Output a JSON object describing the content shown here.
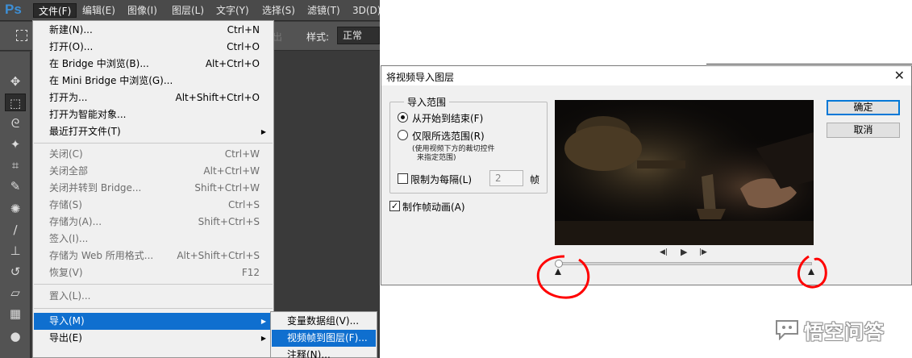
{
  "photoshop": {
    "logo": "Ps",
    "menubar": [
      "文件(F)",
      "编辑(E)",
      "图像(I)",
      "图层(L)",
      "文字(Y)",
      "选择(S)",
      "滤镜(T)",
      "3D(D)"
    ],
    "options": {
      "hidden_text": "出",
      "style_label": "样式:",
      "style_value": "正常"
    },
    "tool_icons": [
      "move-tool-icon",
      "marquee-tool-icon",
      "lasso-tool-icon",
      "magic-wand-icon",
      "crop-tool-icon",
      "eyedropper-icon",
      "healing-brush-icon",
      "brush-tool-icon",
      "clone-stamp-icon",
      "history-brush-icon",
      "eraser-icon",
      "gradient-tool-icon",
      "blur-tool-icon"
    ],
    "file_menu": {
      "items": [
        {
          "label": "新建(N)...",
          "shortcut": "Ctrl+N"
        },
        {
          "label": "打开(O)...",
          "shortcut": "Ctrl+O"
        },
        {
          "label": "在 Bridge 中浏览(B)...",
          "shortcut": "Alt+Ctrl+O"
        },
        {
          "label": "在 Mini Bridge 中浏览(G)...",
          "shortcut": ""
        },
        {
          "label": "打开为...",
          "shortcut": "Alt+Shift+Ctrl+O"
        },
        {
          "label": "打开为智能对象...",
          "shortcut": ""
        },
        {
          "label": "最近打开文件(T)",
          "shortcut": ""
        },
        {
          "label": "关闭(C)",
          "shortcut": "Ctrl+W"
        },
        {
          "label": "关闭全部",
          "shortcut": "Alt+Ctrl+W"
        },
        {
          "label": "关闭并转到 Bridge...",
          "shortcut": "Shift+Ctrl+W"
        },
        {
          "label": "存储(S)",
          "shortcut": "Ctrl+S"
        },
        {
          "label": "存储为(A)...",
          "shortcut": "Shift+Ctrl+S"
        },
        {
          "label": "签入(I)...",
          "shortcut": ""
        },
        {
          "label": "存储为 Web 所用格式...",
          "shortcut": "Alt+Shift+Ctrl+S"
        },
        {
          "label": "恢复(V)",
          "shortcut": "F12"
        },
        {
          "label": "置入(L)...",
          "shortcut": ""
        },
        {
          "label": "导入(M)",
          "shortcut": ""
        },
        {
          "label": "导出(E)",
          "shortcut": ""
        }
      ]
    },
    "import_submenu": {
      "items": [
        "变量数据组(V)...",
        "视频帧到图层(F)...",
        "注释(N)..."
      ]
    }
  },
  "dialog": {
    "title": "将视频导入图层",
    "close_glyph": "✕",
    "range_group_title": "导入范围",
    "radio_full": "从开始到结束(F)",
    "radio_selected": "仅限所选范围(R)",
    "radio_note_line1": "(使用视频下方的裁切控件",
    "radio_note_line2": "来指定范围)",
    "limit_label": "限制为每隔(L)",
    "limit_value": "2",
    "frames_unit": "帧",
    "make_animation_label": "制作帧动画(A)",
    "make_animation_check": "✓",
    "ok_button": "确定",
    "cancel_button": "取消",
    "transport": {
      "prev": "◀|",
      "play": "▶",
      "next": "|▶"
    }
  },
  "watermark": {
    "text": "悟空问答"
  },
  "colors": {
    "annotation_red": "#ff0000",
    "menu_highlight": "#0f6fcf",
    "ps_blue": "#3d8fd6"
  }
}
